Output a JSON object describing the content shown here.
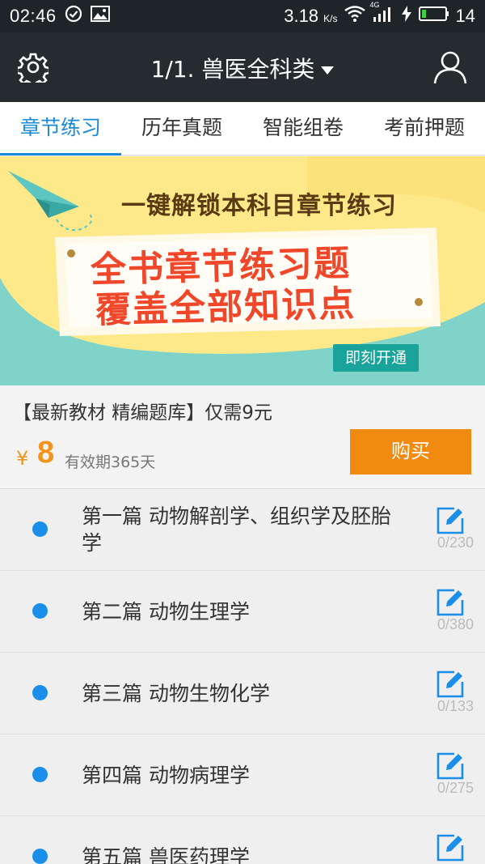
{
  "status_bar": {
    "time": "02:46",
    "speed": "3.18",
    "speed_unit": "K/s",
    "network": "4G",
    "battery": "14",
    "icons": [
      "check-circle-icon",
      "image-icon",
      "wifi-icon",
      "signal-icon",
      "charging-icon",
      "battery-icon"
    ]
  },
  "header": {
    "title": "1/1. 兽医全科类",
    "icons": [
      "gear-icon",
      "caret-down-icon",
      "user-icon"
    ]
  },
  "tabs": [
    {
      "label": "章节练习",
      "active": true
    },
    {
      "label": "历年真题",
      "active": false
    },
    {
      "label": "智能组卷",
      "active": false
    },
    {
      "label": "考前押题",
      "active": false
    }
  ],
  "banner": {
    "headline": "一键解锁本科目章节练习",
    "line1": "全书章节练习题",
    "line2": "覆盖全部知识点",
    "button": "即刻开通"
  },
  "purchase": {
    "description": "【最新教材 精编题库】仅需9元",
    "currency": "¥",
    "price": "8",
    "validity": "有效期365天",
    "buy_label": "购买"
  },
  "chapters": [
    {
      "title": "第一篇 动物解剖学、组织学及胚胎学",
      "count": "0/230"
    },
    {
      "title": "第二篇 动物生理学",
      "count": "0/380"
    },
    {
      "title": "第三篇 动物生物化学",
      "count": "0/133"
    },
    {
      "title": "第四篇 动物病理学",
      "count": "0/275"
    },
    {
      "title": "第五篇 兽医药理学",
      "count": ""
    }
  ],
  "colors": {
    "accent": "#1a8ad6",
    "buy_button": "#f08a10",
    "price": "#f0941e",
    "header_bg": "#262b30",
    "banner_bg": "#fde98a",
    "banner_teal": "#7fd3c9",
    "banner_red": "#f0462a"
  }
}
